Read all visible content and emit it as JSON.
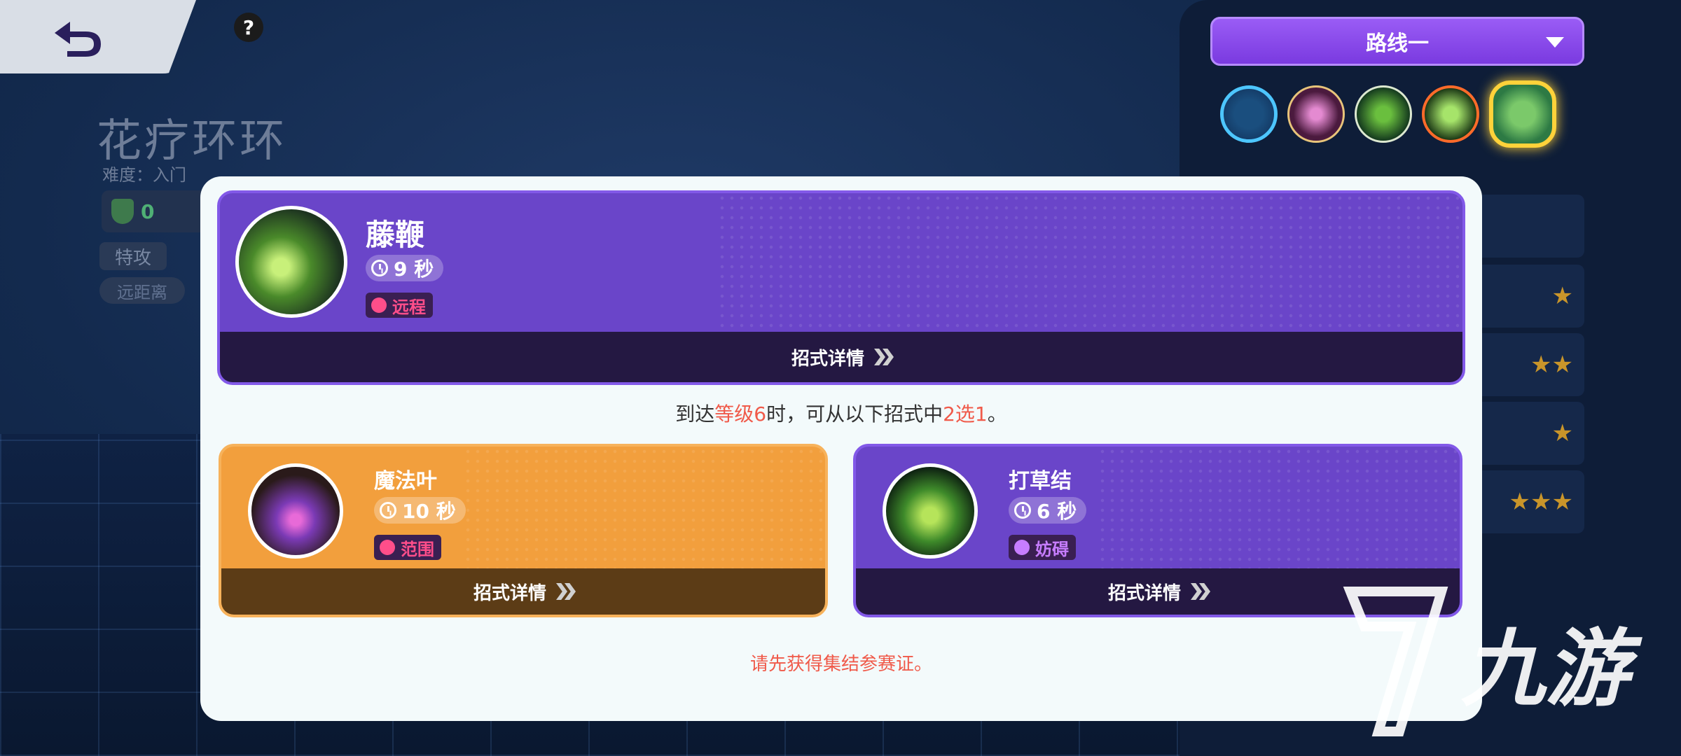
{
  "hero": {
    "name": "花疗环环",
    "difficulty": "难度：入门",
    "stat_value": "0",
    "help_symbol": "?",
    "tag_attack": "特攻",
    "tag_range": "远距离"
  },
  "route": {
    "selected": "路线一"
  },
  "skill_bar": {
    "icons": [
      "gear-skill-icon",
      "pink-flower-skill-icon",
      "vine-pet-skill-icon",
      "vine-whip-skill-icon",
      "unite-move-icon"
    ]
  },
  "modal": {
    "main_skill": {
      "name": "藤鞭",
      "cooldown": "9 秒",
      "tag": "远程",
      "detail_label": "招式详情"
    },
    "instruction": {
      "prefix": "到达",
      "level": "等级6",
      "middle": "时，可从以下招式中",
      "choice": "2选1",
      "suffix": "。"
    },
    "options": [
      {
        "name": "魔法叶",
        "cooldown": "10 秒",
        "tag": "范围",
        "detail_label": "招式详情"
      },
      {
        "name": "打草结",
        "cooldown": "6 秒",
        "tag": "妨碍",
        "detail_label": "招式详情"
      }
    ],
    "warning": "请先获得集结参赛证。"
  },
  "watermark": {
    "text": "九游"
  },
  "colors": {
    "purple_card": "#6a45c9",
    "orange_card": "#f29f3d",
    "highlight_red": "#f05a4a",
    "tag_pink": "#ff4e8a",
    "tag_violet": "#c77dff"
  }
}
